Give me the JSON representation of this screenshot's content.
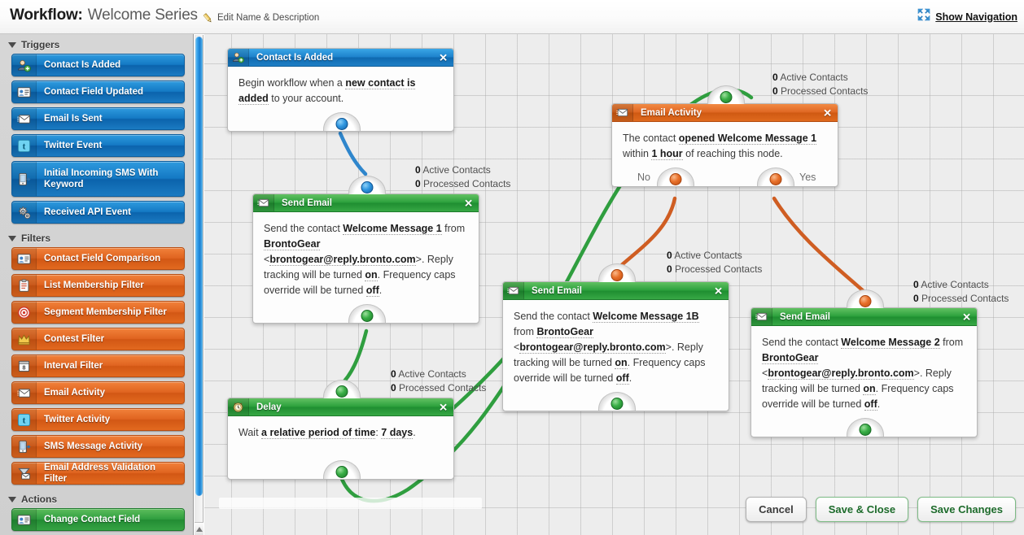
{
  "header": {
    "title_label": "Workflow:",
    "workflow_name": "Welcome Series",
    "edit_link": "Edit Name & Description",
    "edit_icon": "pencil-icon",
    "show_navigation": "Show Navigation",
    "show_navigation_icon": "collapse-arrows-icon"
  },
  "sidebar": {
    "groups": [
      {
        "label": "Triggers",
        "color": "#1479c4",
        "items": [
          {
            "label": "Contact Is Added",
            "icon": "contact-add-icon"
          },
          {
            "label": "Contact Field Updated",
            "icon": "contact-card-icon"
          },
          {
            "label": "Email Is Sent",
            "icon": "envelope-icon"
          },
          {
            "label": "Twitter Event",
            "icon": "twitter-icon"
          },
          {
            "label": "Initial Incoming SMS With Keyword",
            "icon": "sms-device-icon"
          },
          {
            "label": "Received API Event",
            "icon": "gears-icon"
          }
        ]
      },
      {
        "label": "Filters",
        "color": "#e06420",
        "items": [
          {
            "label": "Contact Field Comparison",
            "icon": "contact-card-icon"
          },
          {
            "label": "List Membership Filter",
            "icon": "clipboard-icon"
          },
          {
            "label": "Segment Membership Filter",
            "icon": "target-icon"
          },
          {
            "label": "Contest Filter",
            "icon": "crown-icon"
          },
          {
            "label": "Interval Filter",
            "icon": "calendar-icon"
          },
          {
            "label": "Email Activity",
            "icon": "envelope-icon"
          },
          {
            "label": "Twitter Activity",
            "icon": "twitter-icon"
          },
          {
            "label": "SMS Message Activity",
            "icon": "sms-device-icon"
          },
          {
            "label": "Email Address Validation Filter",
            "icon": "funnel-envelope-icon"
          }
        ]
      },
      {
        "label": "Actions",
        "color": "#2f9e3f",
        "items": [
          {
            "label": "Change Contact Field",
            "icon": "contact-card-icon"
          }
        ]
      }
    ]
  },
  "canvas": {
    "nodes": [
      {
        "id": "contact-is-added",
        "type": "trigger",
        "title": "Contact Is Added",
        "icon": "contact-add-icon",
        "close_icon": "close-icon",
        "body_parts": [
          {
            "t": "Begin workflow when a ",
            "b": false
          },
          {
            "t": "new contact is added",
            "b": true
          },
          {
            "t": " to your account.",
            "b": false
          }
        ]
      },
      {
        "id": "send-email-1",
        "type": "action",
        "title": "Send Email",
        "icon": "envelope-icon",
        "close_icon": "close-icon",
        "body_parts": [
          {
            "t": "Send the contact ",
            "b": false
          },
          {
            "t": "Welcome Message 1",
            "b": true
          },
          {
            "t": " from ",
            "b": false
          },
          {
            "t": "BrontoGear",
            "b": true
          },
          {
            "t": " <",
            "b": false
          },
          {
            "t": "brontogear@reply.bronto.com",
            "b": true
          },
          {
            "t": ">. Reply tracking will be turned ",
            "b": false
          },
          {
            "t": "on",
            "b": true
          },
          {
            "t": ". Frequency caps override will be turned ",
            "b": false
          },
          {
            "t": "off",
            "b": true
          },
          {
            "t": ".",
            "b": false
          }
        ]
      },
      {
        "id": "delay",
        "type": "action",
        "title": "Delay",
        "icon": "clock-icon",
        "close_icon": "close-icon",
        "body_parts": [
          {
            "t": "Wait ",
            "b": false
          },
          {
            "t": "a relative period of time",
            "b": true
          },
          {
            "t": ": ",
            "b": false
          },
          {
            "t": "7 days",
            "b": true
          },
          {
            "t": ".",
            "b": false
          }
        ]
      },
      {
        "id": "email-activity",
        "type": "filter",
        "title": "Email Activity",
        "icon": "envelope-icon",
        "close_icon": "close-icon",
        "body_parts": [
          {
            "t": "The contact ",
            "b": false
          },
          {
            "t": "opened Welcome Message 1",
            "b": true
          },
          {
            "t": " within ",
            "b": false
          },
          {
            "t": "1 hour",
            "b": true
          },
          {
            "t": " of reaching this node.",
            "b": false
          }
        ],
        "branch_no": "No",
        "branch_yes": "Yes"
      },
      {
        "id": "send-email-1b",
        "type": "action",
        "title": "Send Email",
        "icon": "envelope-icon",
        "close_icon": "close-icon",
        "body_parts": [
          {
            "t": "Send the contact ",
            "b": false
          },
          {
            "t": "Welcome Message 1B",
            "b": true
          },
          {
            "t": " from ",
            "b": false
          },
          {
            "t": "BrontoGear",
            "b": true
          },
          {
            "t": " <",
            "b": false
          },
          {
            "t": "brontogear@reply.bronto.com",
            "b": true
          },
          {
            "t": ">. Reply tracking will be turned ",
            "b": false
          },
          {
            "t": "on",
            "b": true
          },
          {
            "t": ". Frequency caps override will be turned ",
            "b": false
          },
          {
            "t": "off",
            "b": true
          },
          {
            "t": ".",
            "b": false
          }
        ]
      },
      {
        "id": "send-email-2",
        "type": "action",
        "title": "Send Email",
        "icon": "envelope-icon",
        "close_icon": "close-icon",
        "body_parts": [
          {
            "t": "Send the contact ",
            "b": false
          },
          {
            "t": "Welcome Message 2",
            "b": true
          },
          {
            "t": " from ",
            "b": false
          },
          {
            "t": "BrontoGear",
            "b": true
          },
          {
            "t": " <",
            "b": false
          },
          {
            "t": "brontogear@reply.bronto.com",
            "b": true
          },
          {
            "t": ">. Reply tracking will be turned ",
            "b": false
          },
          {
            "t": "on",
            "b": true
          },
          {
            "t": ". Frequency caps override will be turned ",
            "b": false
          },
          {
            "t": "off",
            "b": true
          },
          {
            "t": ".",
            "b": false
          }
        ]
      }
    ],
    "stats": [
      {
        "active_count": "0",
        "active_label": "Active Contacts",
        "processed_count": "0",
        "processed_label": "Processed Contacts"
      },
      {
        "active_count": "0",
        "active_label": "Active Contacts",
        "processed_count": "0",
        "processed_label": "Processed Contacts"
      },
      {
        "active_count": "0",
        "active_label": "Active Contacts",
        "processed_count": "0",
        "processed_label": "Processed Contacts"
      },
      {
        "active_count": "0",
        "active_label": "Active Contacts",
        "processed_count": "0",
        "processed_label": "Processed Contacts"
      },
      {
        "active_count": "0",
        "active_label": "Active Contacts",
        "processed_count": "0",
        "processed_label": "Processed Contacts"
      }
    ]
  },
  "footer": {
    "cancel": "Cancel",
    "save_close": "Save & Close",
    "save_changes": "Save Changes"
  },
  "colors": {
    "trigger_blue": "#1479c4",
    "filter_orange": "#e06420",
    "action_green": "#2f9e3f"
  }
}
